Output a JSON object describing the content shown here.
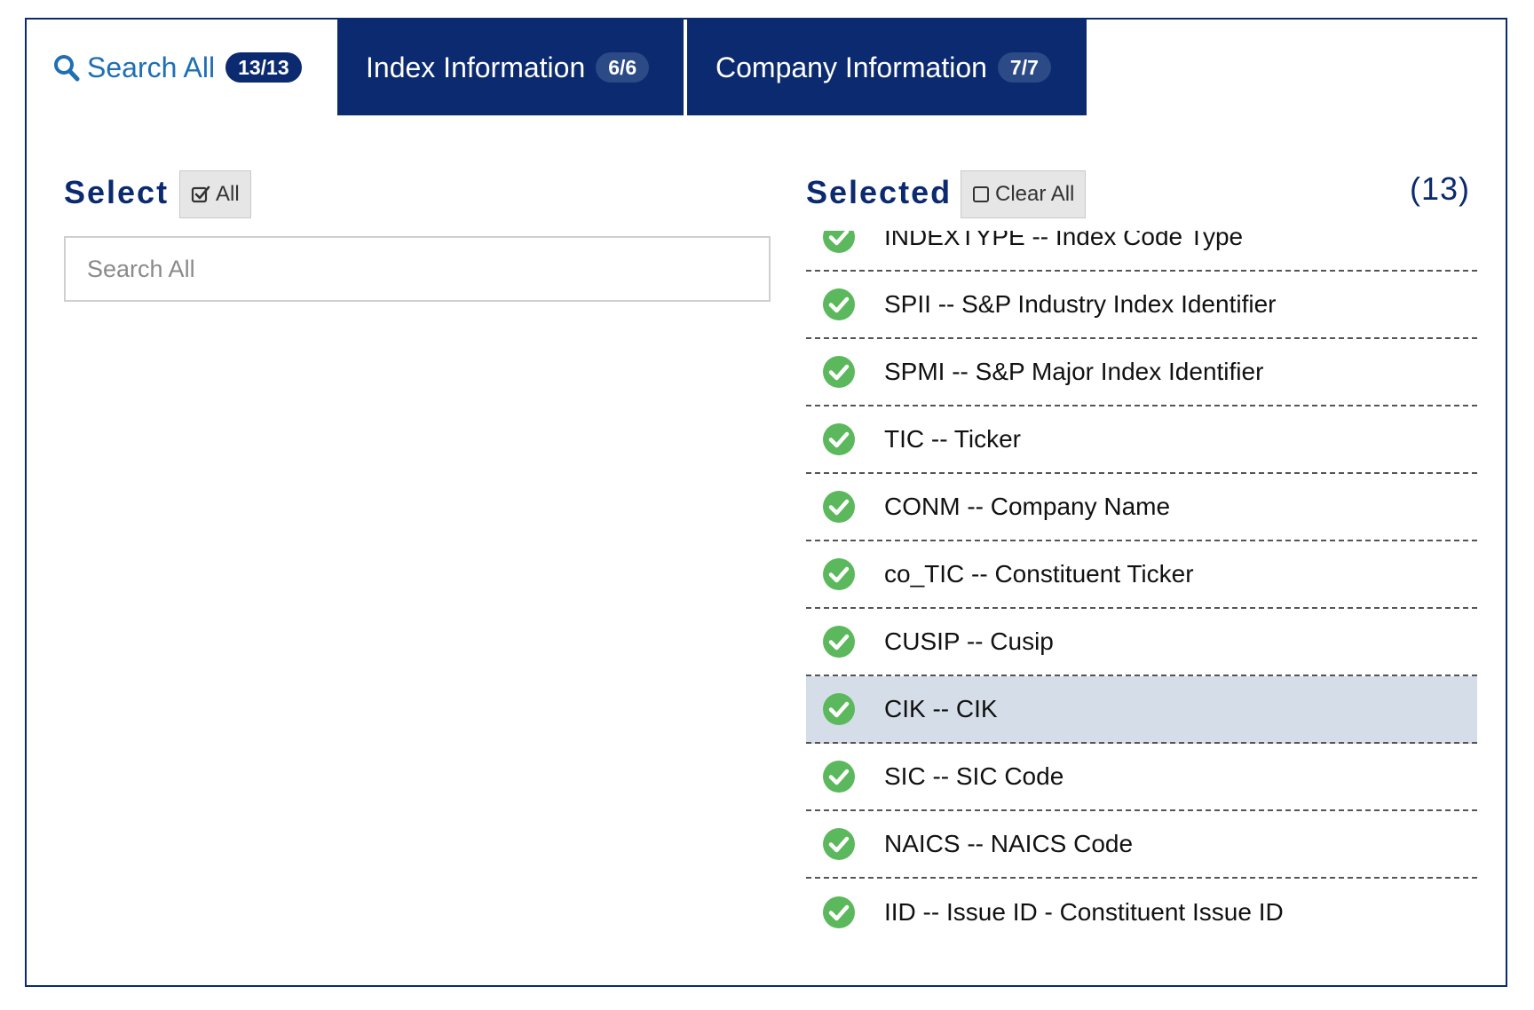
{
  "tabs": {
    "search": {
      "label": "Search All",
      "badge": "13/13",
      "icon": "search-icon"
    },
    "index": {
      "label": "Index Information",
      "badge": "6/6"
    },
    "company": {
      "label": "Company Information",
      "badge": "7/7"
    }
  },
  "select_panel": {
    "heading": "Select",
    "all_button": {
      "label": "All",
      "icon": "checked-square-icon"
    },
    "search_placeholder": "Search All",
    "search_value": ""
  },
  "selected_panel": {
    "heading": "Selected",
    "clear_button": {
      "label": "Clear All",
      "icon": "empty-square-icon"
    },
    "count": "(13)",
    "items": [
      {
        "label": "INDEXTYPE -- Index Code Type"
      },
      {
        "label": "SPII -- S&P Industry Index Identifier"
      },
      {
        "label": "SPMI -- S&P Major Index Identifier"
      },
      {
        "label": "TIC -- Ticker"
      },
      {
        "label": "CONM -- Company Name"
      },
      {
        "label": "co_TIC -- Constituent Ticker"
      },
      {
        "label": "CUSIP -- Cusip"
      },
      {
        "label": "CIK -- CIK",
        "highlighted": true
      },
      {
        "label": "SIC -- SIC Code"
      },
      {
        "label": "NAICS -- NAICS Code"
      },
      {
        "label": "IID -- Issue ID - Constituent Issue ID"
      }
    ]
  },
  "colors": {
    "navy": "#0b2a6f",
    "link_blue": "#1f6fb5",
    "check_green": "#5cb85c",
    "highlight_row": "#d4dde8"
  }
}
